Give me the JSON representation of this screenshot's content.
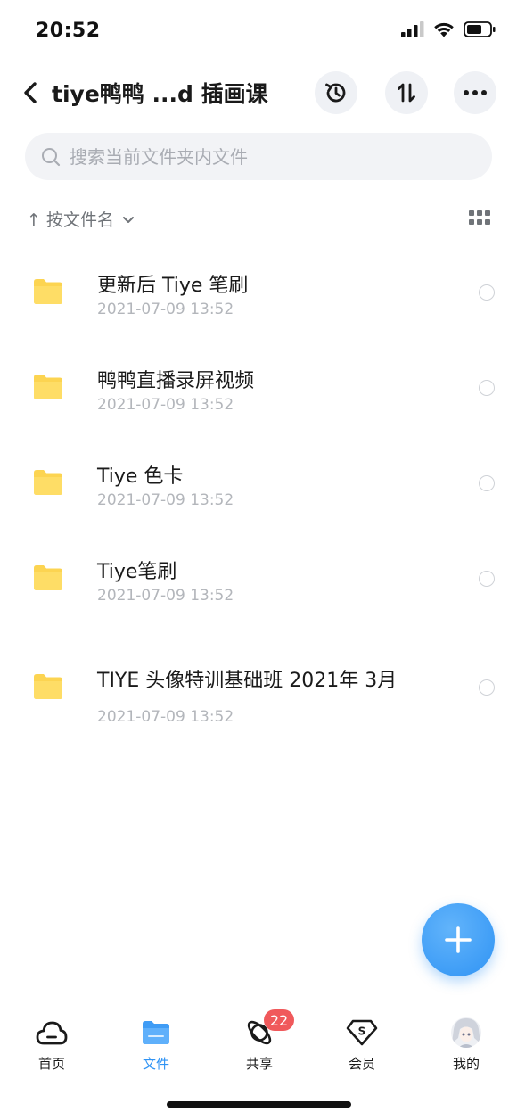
{
  "status_bar": {
    "time": "20:52"
  },
  "nav": {
    "title": "tiye鸭鸭 ...d 插画课"
  },
  "search": {
    "placeholder": "搜索当前文件夹内文件"
  },
  "sort": {
    "label": "↑ 按文件名"
  },
  "files": [
    {
      "name": "更新后 Tiye 笔刷",
      "date": "2021-07-09 13:52"
    },
    {
      "name": "鸭鸭直播录屏视频",
      "date": "2021-07-09 13:52"
    },
    {
      "name": "Tiye 色卡",
      "date": "2021-07-09 13:52"
    },
    {
      "name": "Tiye笔刷",
      "date": "2021-07-09 13:52"
    },
    {
      "name": "TIYE 头像特训基础班 2021年 3月",
      "date": "2021-07-09 13:52"
    }
  ],
  "tabs": [
    {
      "label": "首页",
      "icon": "cloud-icon"
    },
    {
      "label": "文件",
      "icon": "folder-icon"
    },
    {
      "label": "共享",
      "icon": "share-orbit-icon",
      "badge": "22"
    },
    {
      "label": "会员",
      "icon": "vip-diamond-icon"
    },
    {
      "label": "我的",
      "icon": "avatar"
    }
  ],
  "colors": {
    "accent": "#2f93f4",
    "folder": "#fdd85d",
    "badge": "#f0595b"
  }
}
